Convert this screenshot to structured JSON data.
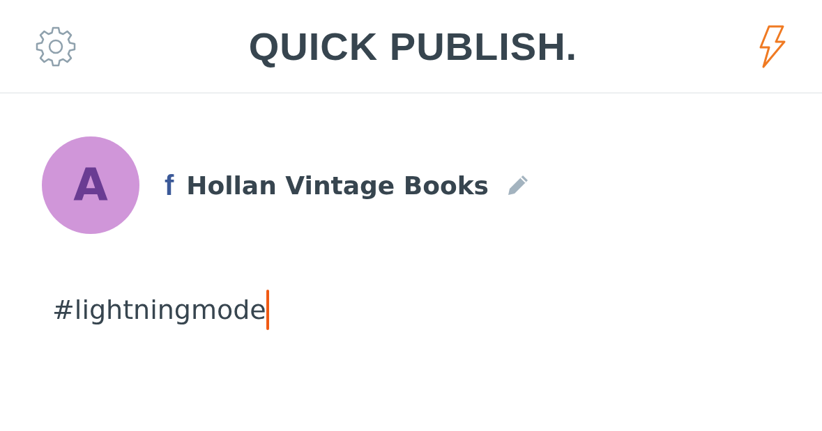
{
  "header": {
    "title": "QUICK PUBLISH."
  },
  "account": {
    "avatar_letter": "A",
    "network_glyph": "f",
    "name": "Hollan Vintage Books"
  },
  "composer": {
    "value": "#lightningmode",
    "focused": true
  }
}
